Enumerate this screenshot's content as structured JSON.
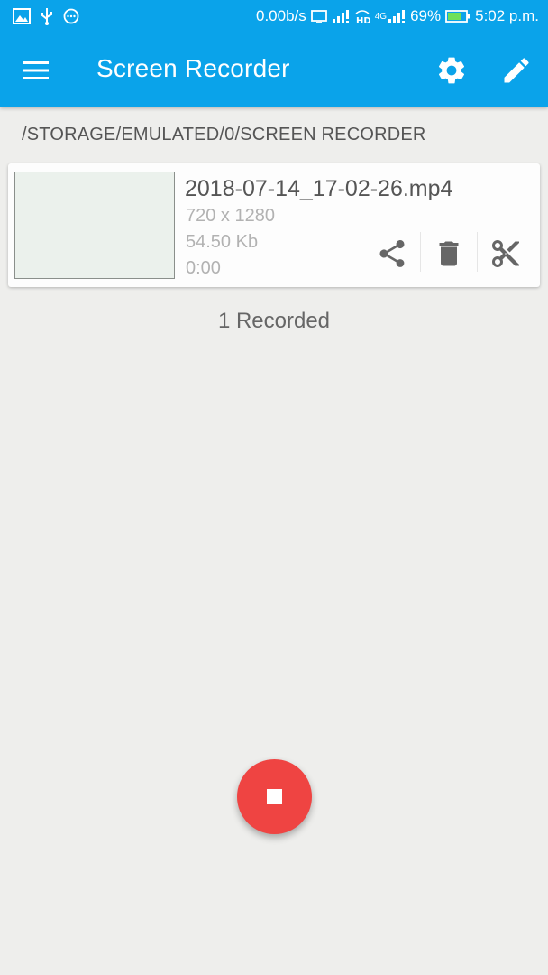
{
  "status_bar": {
    "net_speed": "0.00b/s",
    "network_type": "4G",
    "battery": "69%",
    "time": "5:02 p.m.",
    "icons_left": [
      "image-icon",
      "usb-icon",
      "more-circle-icon"
    ],
    "icons_right": [
      "cast-icon",
      "signal-icon",
      "hd-icon",
      "signal-4g-icon",
      "battery-icon"
    ]
  },
  "toolbar": {
    "title": "Screen Recorder",
    "color": "#0aa3ea",
    "icons": [
      "menu-icon",
      "gear-icon",
      "pencil-icon"
    ]
  },
  "path": "/STORAGE/EMULATED/0/SCREEN RECORDER",
  "recordings": [
    {
      "filename": "2018-07-14_17-02-26.mp4",
      "resolution": "720 x 1280",
      "size": "54.50 Kb",
      "duration": "0:00",
      "actions": [
        "share-icon",
        "trash-icon",
        "scissors-icon"
      ]
    }
  ],
  "count_label": "1 Recorded",
  "fab": {
    "icon": "stop-icon",
    "color": "#ef4442"
  }
}
